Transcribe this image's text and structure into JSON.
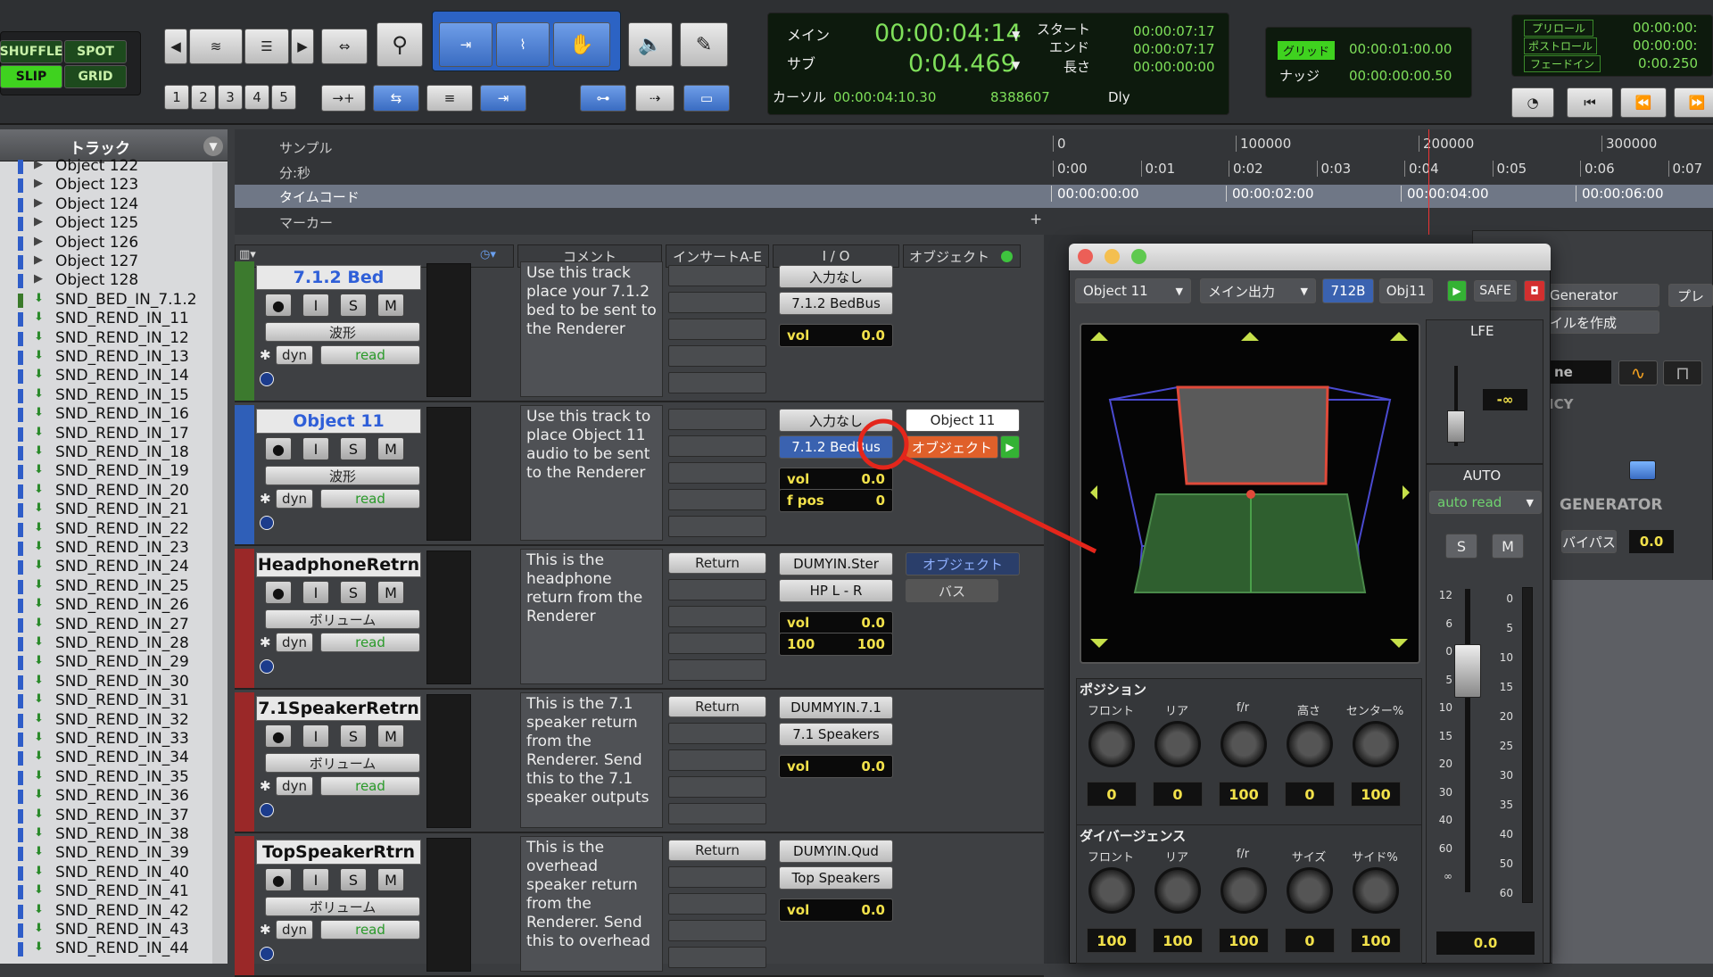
{
  "toolbar": {
    "shuffle": "SHUFFLE",
    "spot": "SPOT",
    "slip": "SLIP",
    "grid": "GRID",
    "nums": [
      "1",
      "2",
      "3",
      "4",
      "5"
    ]
  },
  "counter": {
    "main_label": "メイン",
    "sub_label": "サブ",
    "main_time": "00:00:04:14",
    "sub_time": "0:04.469",
    "start_label": "スタート",
    "end_label": "エンド",
    "length_label": "長さ",
    "start": "00:00:07:17",
    "end": "00:00:07:17",
    "length": "00:00:00:00",
    "cursor_label": "カーソル",
    "cursor": "00:00:04:10.30",
    "sample": "8388607",
    "dly": "Dly"
  },
  "grid": {
    "grid_label": "グリッド",
    "grid_value": "00:00:01:00.00",
    "nudge_label": "ナッジ",
    "nudge_value": "00:00:00:00.50"
  },
  "preroll": {
    "pre": "プリロール",
    "post": "ポストロール",
    "fade": "フェードイン",
    "v1": "00:00:00:",
    "v2": "00:00:00:",
    "v3": "0:00.250"
  },
  "tracklist": {
    "title": "トラック",
    "items": [
      "Object 122",
      "Object 123",
      "Object 124",
      "Object 125",
      "Object 126",
      "Object 127",
      "Object 128",
      "SND_BED_IN_7.1.2",
      "SND_REND_IN_11",
      "SND_REND_IN_12",
      "SND_REND_IN_13",
      "SND_REND_IN_14",
      "SND_REND_IN_15",
      "SND_REND_IN_16",
      "SND_REND_IN_17",
      "SND_REND_IN_18",
      "SND_REND_IN_19",
      "SND_REND_IN_20",
      "SND_REND_IN_21",
      "SND_REND_IN_22",
      "SND_REND_IN_23",
      "SND_REND_IN_24",
      "SND_REND_IN_25",
      "SND_REND_IN_26",
      "SND_REND_IN_27",
      "SND_REND_IN_28",
      "SND_REND_IN_29",
      "SND_REND_IN_30",
      "SND_REND_IN_31",
      "SND_REND_IN_32",
      "SND_REND_IN_33",
      "SND_REND_IN_34",
      "SND_REND_IN_35",
      "SND_REND_IN_36",
      "SND_REND_IN_37",
      "SND_REND_IN_38",
      "SND_REND_IN_39",
      "SND_REND_IN_40",
      "SND_REND_IN_41",
      "SND_REND_IN_42",
      "SND_REND_IN_43",
      "SND_REND_IN_44"
    ]
  },
  "rulers": {
    "sample": "サンプル",
    "minsec": "分:秒",
    "timecode": "タイムコード",
    "marker": "マーカー",
    "samples": [
      "0",
      "100000",
      "200000",
      "300000"
    ],
    "minsecs": [
      "0:00",
      "0:01",
      "0:02",
      "0:03",
      "0:04",
      "0:05",
      "0:06",
      "0:07"
    ],
    "timecodes": [
      "00:00:00:00",
      "00:00:02:00",
      "00:00:04:00",
      "00:00:06:00"
    ]
  },
  "columns": {
    "comment": "コメント",
    "inserts": "インサートA-E",
    "io": "I / O",
    "object": "オブジェクト"
  },
  "tracks": [
    {
      "name": "7.1.2 Bed",
      "view": "波形",
      "dyn": "dyn",
      "mode": "read",
      "comment": "Use this track place your 7.1.2 bed to be sent to the Renderer",
      "input": "入力なし",
      "output": "7.1.2 BedBus",
      "vol_label": "vol",
      "vol": "0.0"
    },
    {
      "name": "Object 11",
      "view": "波形",
      "dyn": "dyn",
      "mode": "read",
      "comment": "Use this track to place Object 11 audio to be sent to the Renderer",
      "input": "入力なし",
      "output": "7.1.2 BedBus",
      "vol_label": "vol",
      "vol": "0.0",
      "fpos_label": "f pos",
      "fpos": "0",
      "obj_name": "Object 11",
      "obj_btn": "オブジェクト"
    },
    {
      "name": "HeadphoneRetrn",
      "view": "ボリューム",
      "dyn": "dyn",
      "mode": "read",
      "comment": "This is the headphone return from the Renderer",
      "insert": "Return",
      "input": "DUMYIN.Ster",
      "output": "HP L - R",
      "vol_label": "vol",
      "vol": "0.0",
      "pan_l": "100",
      "pan_r": "100",
      "obj_btn": "オブジェクト",
      "bus_btn": "バス"
    },
    {
      "name": "7.1SpeakerRetrn",
      "view": "ボリューム",
      "dyn": "dyn",
      "mode": "read",
      "comment": "This is the 7.1 speaker return from the Renderer. Send this to the 7.1 speaker outputs",
      "insert": "Return",
      "input": "DUMMYIN.7.1",
      "output": "7.1 Speakers",
      "vol_label": "vol",
      "vol": "0.0"
    },
    {
      "name": "TopSpeakerRtrn",
      "view": "ボリューム",
      "dyn": "dyn",
      "mode": "read",
      "comment": "This is the overhead speaker return from the Renderer. Send this to overhead",
      "insert": "Return",
      "input": "DUMYIN.Qud",
      "output": "Top Speakers",
      "vol_label": "vol",
      "vol": "0.0"
    }
  ],
  "plugin": {
    "track": "Object 11",
    "output": "メイン出力",
    "fmt": "712B",
    "obj": "Obj11",
    "safe": "SAFE",
    "lfe": "LFE",
    "lfe_val": "-∞",
    "auto": "AUTO",
    "auto_mode": "auto read",
    "s": "S",
    "m": "M",
    "position_title": "ポジション",
    "position_labels": [
      "フロント",
      "リア",
      "f/r",
      "高さ",
      "センター%"
    ],
    "position_values": [
      "0",
      "0",
      "100",
      "0",
      "100"
    ],
    "divergence_title": "ダイバージェンス",
    "divergence_labels": [
      "フロント",
      "リア",
      "f/r",
      "サイズ",
      "サイド%"
    ],
    "divergence_values": [
      "100",
      "100",
      "100",
      "0",
      "100"
    ],
    "fader_value": "0.0",
    "scale_left": [
      "12",
      "6",
      "0",
      "5",
      "10",
      "15",
      "20",
      "30",
      "40",
      "60",
      "∞"
    ],
    "scale_right": [
      "0",
      "5",
      "10",
      "15",
      "20",
      "25",
      "30",
      "35",
      "40",
      "50",
      "60"
    ]
  },
  "bgplugin": {
    "name": "Generator",
    "make": "イルを作成",
    "play": "プレ",
    "ne": "ne",
    "icy": "ICY",
    "generator": "GENERATOR",
    "bypass": "バイパス",
    "val": "0.0"
  }
}
